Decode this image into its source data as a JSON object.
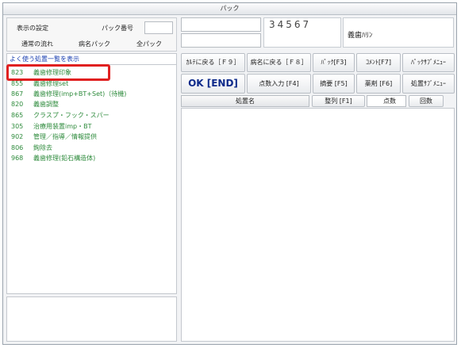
{
  "window": {
    "title": "パック"
  },
  "left": {
    "display_settings": "表示の設定",
    "pack_number_label": "パック番号",
    "pack_number_value": "",
    "normal_flow": "通常の流れ",
    "disease_pack": "病名パック",
    "all_pack": "全パック",
    "frequent_header": "よく使う処置一覧を表示",
    "items": [
      {
        "code": "823",
        "name": "義歯修理印象"
      },
      {
        "code": "855",
        "name": "義歯修理set"
      },
      {
        "code": "867",
        "name": "義歯修理(imp+BT+Set)（待機)"
      },
      {
        "code": "820",
        "name": "義歯調整"
      },
      {
        "code": "865",
        "name": "クラスプ・フック・スパー"
      },
      {
        "code": "305",
        "name": "治療用装置imp・BT"
      },
      {
        "code": "902",
        "name": "管理／指導／情報提供"
      },
      {
        "code": "806",
        "name": "鉤除去"
      },
      {
        "code": "968",
        "name": "義歯修理(鉛石構造体)"
      }
    ]
  },
  "right": {
    "input_a": "",
    "input_b": "",
    "number_field": "34567",
    "category_label": "義歯ﾊﾘﾝ",
    "buttons": {
      "back_to_chart": "ｶﾙﾃに戻る［Ｆ９］",
      "back_to_disease": "病名に戻る［Ｆ８］",
      "pack": "ﾊﾟｯｸ[F3]",
      "comment": "ｺﾒﾝﾄ[F7]",
      "pack_submenu": "ﾊﾟｯｸｻﾌﾞﾒﾆｭｰ",
      "ok_end": "OK [END]",
      "points_input": "点数入力 [F4]",
      "summary": "摘要 [F5]",
      "drug": "薬剤 [F6]",
      "treatment_submenu": "処置ｻﾌﾞﾒﾆｭｰ"
    },
    "table_header": {
      "treatment_name": "処置名",
      "sort": "整列 [F1]",
      "points": "点数",
      "count": "回数"
    }
  },
  "colors": {
    "list_text": "#2e8b3c",
    "ok_text": "#0d2a8a",
    "highlight_border": "#e02020"
  }
}
